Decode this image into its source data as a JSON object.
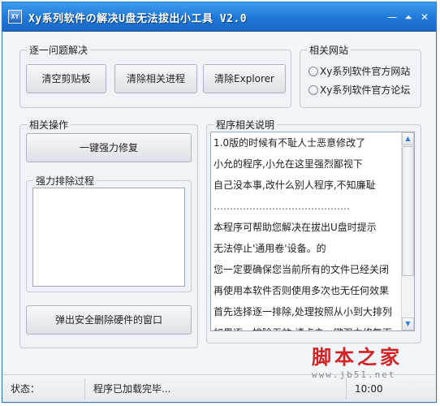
{
  "window": {
    "icon_text": "XY",
    "title": "Xy系列软件の解决U盘无法拔出小工具 V2.0",
    "controls": {
      "minimize": "—",
      "restore": "⏶",
      "close": "✕"
    }
  },
  "problem_group": {
    "legend": "逐一问题解决",
    "buttons": [
      "清空剪贴板",
      "清除相关进程",
      "清除Explorer"
    ]
  },
  "links_group": {
    "legend": "相关网站",
    "options": [
      "Xy系列软件官方网站",
      "Xy系列软件官方论坛"
    ]
  },
  "ops_group": {
    "legend": "相关操作",
    "force_repair_button": "一键强力修复",
    "process_legend": "强力排除过程",
    "eject_button": "弹出安全删除硬件的窗口"
  },
  "desc_group": {
    "legend": "程序相关说明",
    "lines": [
      "1.0版的时候有不耻人士恶意修改了",
      "小允的程序,小允在这里强烈鄙视下",
      "自己没本事,改什么别人程序,不知廉耻",
      "……………………………………",
      "本程序可帮助您解决在拔出U盘时提示",
      "无法停止'通用卷'设备。的",
      "您一定要确保您当前所有的文件已经关闭",
      "再使用本软件否则使用多次也无任何效果",
      "首先选择逐一排除,处理按照从小到大排列",
      "如果逐一排除无效,请点击一键强力修复下"
    ],
    "scroll": {
      "up": "▲",
      "down": "▼"
    }
  },
  "status": {
    "label": "状态：",
    "message": "程序已加载完毕...",
    "time": "10:00"
  },
  "watermark": {
    "logo": "脚本之家",
    "url": "www.jb51.net"
  }
}
